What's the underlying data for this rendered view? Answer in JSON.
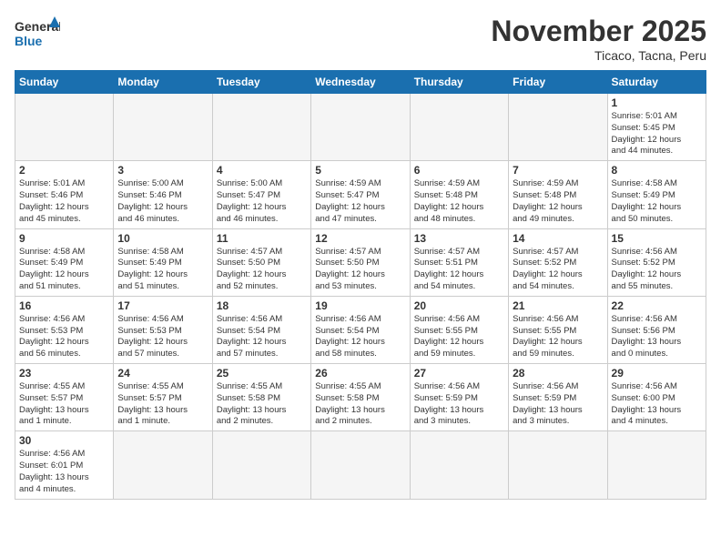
{
  "header": {
    "logo_general": "General",
    "logo_blue": "Blue",
    "month_title": "November 2025",
    "location": "Ticaco, Tacna, Peru"
  },
  "weekdays": [
    "Sunday",
    "Monday",
    "Tuesday",
    "Wednesday",
    "Thursday",
    "Friday",
    "Saturday"
  ],
  "weeks": [
    [
      {
        "day": "",
        "info": ""
      },
      {
        "day": "",
        "info": ""
      },
      {
        "day": "",
        "info": ""
      },
      {
        "day": "",
        "info": ""
      },
      {
        "day": "",
        "info": ""
      },
      {
        "day": "",
        "info": ""
      },
      {
        "day": "1",
        "info": "Sunrise: 5:01 AM\nSunset: 5:45 PM\nDaylight: 12 hours\nand 44 minutes."
      }
    ],
    [
      {
        "day": "2",
        "info": "Sunrise: 5:01 AM\nSunset: 5:46 PM\nDaylight: 12 hours\nand 45 minutes."
      },
      {
        "day": "3",
        "info": "Sunrise: 5:00 AM\nSunset: 5:46 PM\nDaylight: 12 hours\nand 46 minutes."
      },
      {
        "day": "4",
        "info": "Sunrise: 5:00 AM\nSunset: 5:47 PM\nDaylight: 12 hours\nand 46 minutes."
      },
      {
        "day": "5",
        "info": "Sunrise: 4:59 AM\nSunset: 5:47 PM\nDaylight: 12 hours\nand 47 minutes."
      },
      {
        "day": "6",
        "info": "Sunrise: 4:59 AM\nSunset: 5:48 PM\nDaylight: 12 hours\nand 48 minutes."
      },
      {
        "day": "7",
        "info": "Sunrise: 4:59 AM\nSunset: 5:48 PM\nDaylight: 12 hours\nand 49 minutes."
      },
      {
        "day": "8",
        "info": "Sunrise: 4:58 AM\nSunset: 5:49 PM\nDaylight: 12 hours\nand 50 minutes."
      }
    ],
    [
      {
        "day": "9",
        "info": "Sunrise: 4:58 AM\nSunset: 5:49 PM\nDaylight: 12 hours\nand 51 minutes."
      },
      {
        "day": "10",
        "info": "Sunrise: 4:58 AM\nSunset: 5:49 PM\nDaylight: 12 hours\nand 51 minutes."
      },
      {
        "day": "11",
        "info": "Sunrise: 4:57 AM\nSunset: 5:50 PM\nDaylight: 12 hours\nand 52 minutes."
      },
      {
        "day": "12",
        "info": "Sunrise: 4:57 AM\nSunset: 5:50 PM\nDaylight: 12 hours\nand 53 minutes."
      },
      {
        "day": "13",
        "info": "Sunrise: 4:57 AM\nSunset: 5:51 PM\nDaylight: 12 hours\nand 54 minutes."
      },
      {
        "day": "14",
        "info": "Sunrise: 4:57 AM\nSunset: 5:52 PM\nDaylight: 12 hours\nand 54 minutes."
      },
      {
        "day": "15",
        "info": "Sunrise: 4:56 AM\nSunset: 5:52 PM\nDaylight: 12 hours\nand 55 minutes."
      }
    ],
    [
      {
        "day": "16",
        "info": "Sunrise: 4:56 AM\nSunset: 5:53 PM\nDaylight: 12 hours\nand 56 minutes."
      },
      {
        "day": "17",
        "info": "Sunrise: 4:56 AM\nSunset: 5:53 PM\nDaylight: 12 hours\nand 57 minutes."
      },
      {
        "day": "18",
        "info": "Sunrise: 4:56 AM\nSunset: 5:54 PM\nDaylight: 12 hours\nand 57 minutes."
      },
      {
        "day": "19",
        "info": "Sunrise: 4:56 AM\nSunset: 5:54 PM\nDaylight: 12 hours\nand 58 minutes."
      },
      {
        "day": "20",
        "info": "Sunrise: 4:56 AM\nSunset: 5:55 PM\nDaylight: 12 hours\nand 59 minutes."
      },
      {
        "day": "21",
        "info": "Sunrise: 4:56 AM\nSunset: 5:55 PM\nDaylight: 12 hours\nand 59 minutes."
      },
      {
        "day": "22",
        "info": "Sunrise: 4:56 AM\nSunset: 5:56 PM\nDaylight: 13 hours\nand 0 minutes."
      }
    ],
    [
      {
        "day": "23",
        "info": "Sunrise: 4:55 AM\nSunset: 5:57 PM\nDaylight: 13 hours\nand 1 minute."
      },
      {
        "day": "24",
        "info": "Sunrise: 4:55 AM\nSunset: 5:57 PM\nDaylight: 13 hours\nand 1 minute."
      },
      {
        "day": "25",
        "info": "Sunrise: 4:55 AM\nSunset: 5:58 PM\nDaylight: 13 hours\nand 2 minutes."
      },
      {
        "day": "26",
        "info": "Sunrise: 4:55 AM\nSunset: 5:58 PM\nDaylight: 13 hours\nand 2 minutes."
      },
      {
        "day": "27",
        "info": "Sunrise: 4:56 AM\nSunset: 5:59 PM\nDaylight: 13 hours\nand 3 minutes."
      },
      {
        "day": "28",
        "info": "Sunrise: 4:56 AM\nSunset: 5:59 PM\nDaylight: 13 hours\nand 3 minutes."
      },
      {
        "day": "29",
        "info": "Sunrise: 4:56 AM\nSunset: 6:00 PM\nDaylight: 13 hours\nand 4 minutes."
      }
    ],
    [
      {
        "day": "30",
        "info": "Sunrise: 4:56 AM\nSunset: 6:01 PM\nDaylight: 13 hours\nand 4 minutes."
      },
      {
        "day": "",
        "info": ""
      },
      {
        "day": "",
        "info": ""
      },
      {
        "day": "",
        "info": ""
      },
      {
        "day": "",
        "info": ""
      },
      {
        "day": "",
        "info": ""
      },
      {
        "day": "",
        "info": ""
      }
    ]
  ]
}
